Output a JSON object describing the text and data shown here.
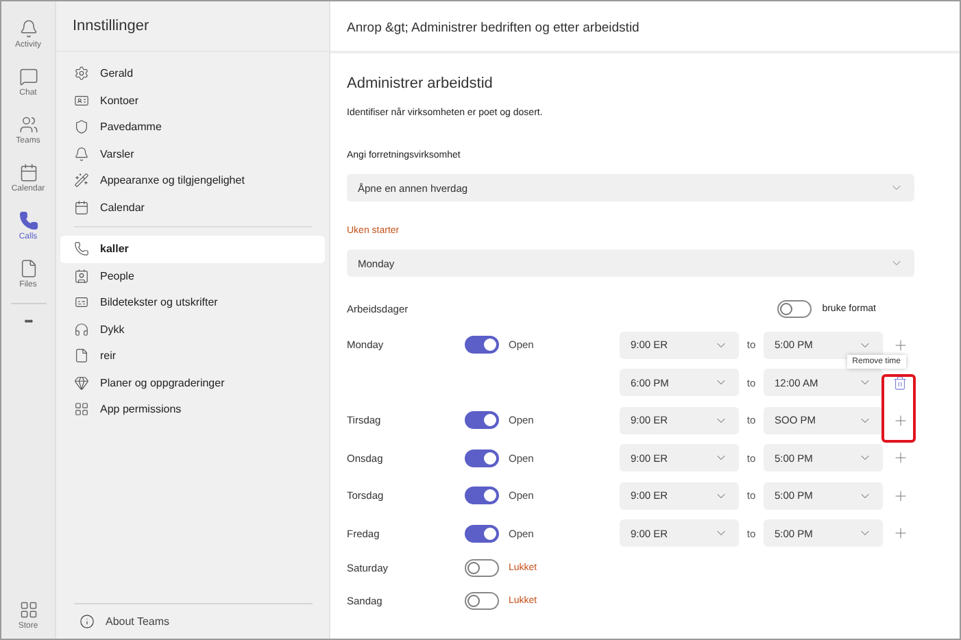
{
  "rail": [
    {
      "label": "Activity",
      "selected": false
    },
    {
      "label": "Chat",
      "selected": false
    },
    {
      "label": "Teams",
      "selected": false
    },
    {
      "label": "Calendar",
      "selected": false
    },
    {
      "label": "Calls",
      "selected": true
    },
    {
      "label": "Files",
      "selected": false
    }
  ],
  "rail_more": "•••",
  "rail_store": {
    "label": "Store"
  },
  "sidebar": {
    "title": "Innstillinger",
    "groups": [
      [
        {
          "label": "Gerald",
          "selected": false
        },
        {
          "label": "Kontoer",
          "selected": false
        },
        {
          "label": "Pavedamme",
          "selected": false
        },
        {
          "label": "Varsler",
          "selected": false
        },
        {
          "label": "Appearanxe og tilgjengelighet",
          "selected": false
        },
        {
          "label": "Calendar",
          "selected": false
        }
      ],
      [
        {
          "label": "kaller",
          "selected": true
        },
        {
          "label": "People",
          "selected": false
        },
        {
          "label": "Bildetekster og utskrifter",
          "selected": false
        },
        {
          "label": "Dykk",
          "selected": false
        },
        {
          "label": "reir",
          "selected": false
        },
        {
          "label": "Planer og oppgraderinger",
          "selected": false
        },
        {
          "label": "App permissions",
          "selected": false
        }
      ]
    ],
    "footer": "About Teams"
  },
  "header": "Anrop &gt; Administrer bedriften og etter arbeidstid",
  "heading": "Administrer arbeidstid",
  "description": "Identifiser når virksomheten er poet og dosert.",
  "fields": [
    {
      "label": "Angi forretningsvirksomhet",
      "value": "Åpne en annen hverdag",
      "accent": false
    },
    {
      "label": "Uken starter",
      "value": "Monday",
      "accent": true
    }
  ],
  "workdays": {
    "label": "Arbeidsdager",
    "format_toggle": {
      "label": "bruke format",
      "on": false
    }
  },
  "days": [
    {
      "name": "Monday",
      "on": true,
      "status": "Open",
      "ranges": [
        {
          "from": "9:00 ER",
          "separator": "to",
          "to": "5:00 PM",
          "kind": "add"
        },
        {
          "from": "6:00 PM",
          "separator": "to",
          "to": "12:00 AM",
          "kind": "remove"
        }
      ]
    },
    {
      "name": "Tirsdag",
      "on": true,
      "status": "Open",
      "ranges": [
        {
          "from": "9:00 ER",
          "separator": "to",
          "to": "SOO PM",
          "kind": "add"
        }
      ]
    },
    {
      "name": "Onsdag",
      "on": true,
      "status": "Open",
      "ranges": [
        {
          "from": "9:00 ER",
          "separator": "to",
          "to": "5:00 PM",
          "kind": "add"
        }
      ]
    },
    {
      "name": "Torsdag",
      "on": true,
      "status": "Open",
      "ranges": [
        {
          "from": "9:00 ER",
          "separator": "to",
          "to": "5:00 PM",
          "kind": "add"
        }
      ]
    },
    {
      "name": "Fredag",
      "on": true,
      "status": "Open",
      "ranges": [
        {
          "from": "9:00 ER",
          "separator": "to",
          "to": "5:00 PM",
          "kind": "add"
        }
      ]
    },
    {
      "name": "Saturday",
      "on": false,
      "status": "Lukket"
    },
    {
      "name": "Sandag",
      "on": false,
      "status": "Lukket"
    }
  ],
  "tooltip": "Remove time"
}
